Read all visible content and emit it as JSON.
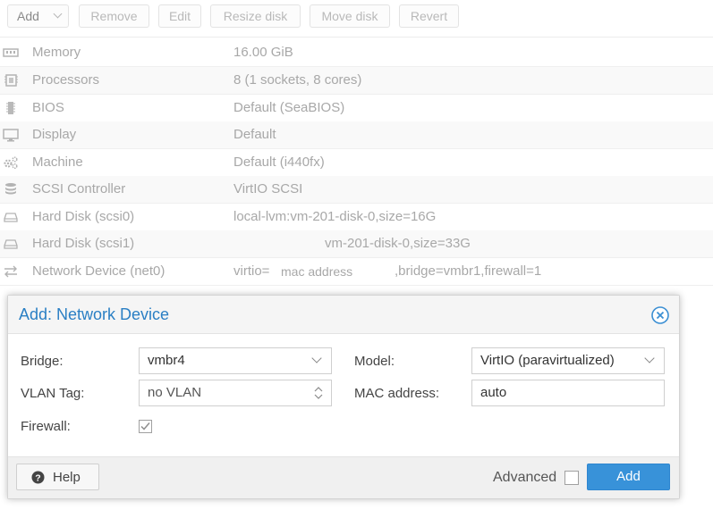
{
  "toolbar": {
    "add": "Add",
    "remove": "Remove",
    "edit": "Edit",
    "resize_disk": "Resize disk",
    "move_disk": "Move disk",
    "revert": "Revert"
  },
  "hardware": [
    {
      "icon": "memory-icon",
      "key": "Memory",
      "value": "16.00 GiB"
    },
    {
      "icon": "processor-icon",
      "key": "Processors",
      "value": "8 (1 sockets, 8 cores)"
    },
    {
      "icon": "bios-chip-icon",
      "key": "BIOS",
      "value": "Default (SeaBIOS)"
    },
    {
      "icon": "display-monitor-icon",
      "key": "Display",
      "value": "Default"
    },
    {
      "icon": "machine-cogs-icon",
      "key": "Machine",
      "value": "Default (i440fx)"
    },
    {
      "icon": "database-icon",
      "key": "SCSI Controller",
      "value": "VirtIO SCSI"
    },
    {
      "icon": "hard-disk-icon",
      "key": "Hard Disk (scsi0)",
      "value": "local-lvm:vm-201-disk-0,size=16G"
    },
    {
      "icon": "hard-disk-icon",
      "key": "Hard Disk (scsi1)",
      "value": "vm-201-disk-0,size=33G"
    },
    {
      "icon": "network-exchange-icon",
      "key": "Network Device (net0)",
      "value_prefix": "virtio=",
      "value_mac": "mac address",
      "value_suffix": ",bridge=vmbr1,firewall=1"
    }
  ],
  "dialog": {
    "title": "Add: Network Device",
    "bridge_label": "Bridge:",
    "bridge_value": "vmbr4",
    "model_label": "Model:",
    "model_value": "VirtIO (paravirtualized)",
    "vlan_label": "VLAN Tag:",
    "vlan_value": "no VLAN",
    "mac_label": "MAC address:",
    "mac_value": "auto",
    "firewall_label": "Firewall:",
    "firewall_checked": true,
    "help_label": "Help",
    "advanced_label": "Advanced",
    "advanced_checked": false,
    "add_label": "Add"
  },
  "colors": {
    "accent": "#3892d9",
    "title": "#2a7fc4"
  }
}
